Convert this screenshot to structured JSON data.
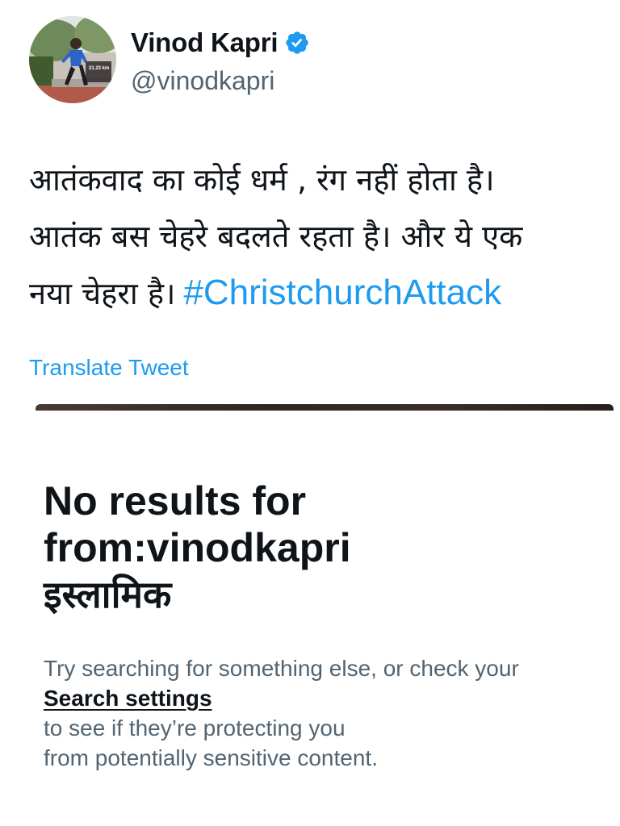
{
  "tweet": {
    "author": {
      "name": "Vinod Kapri",
      "handle": "@vinodkapri",
      "verified": true,
      "avatar_overlay_text": "21.23 km"
    },
    "text_lines": [
      "आतंकवाद का कोई धर्म , रंग नहीं होता है।",
      "आतंक बस चेहरे बदलते रहता है। और ये एक",
      "नया चेहरा है।"
    ],
    "hashtag": "#ChristchurchAttack",
    "translate_label": "Translate Tweet"
  },
  "empty_state": {
    "title_lines": [
      "No results for",
      "from:vinodkapri",
      "इस्लामिक"
    ],
    "description": {
      "line1": "Try searching for something else, or check your",
      "link_text": "Search settings",
      "line2_rest": " to see if they’re protecting you",
      "line3": "from potentially sensitive content."
    }
  },
  "colors": {
    "accent": "#1d9bf0",
    "text_primary": "#0f1419",
    "text_secondary": "#536471"
  },
  "icons": {
    "verified": "verified-badge-icon"
  }
}
